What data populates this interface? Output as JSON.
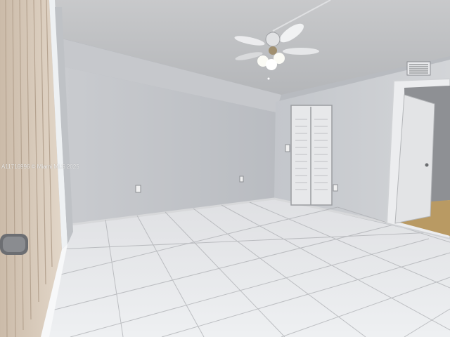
{
  "watermark": {
    "text": "A11716996 © Miami MLS 2025"
  }
}
